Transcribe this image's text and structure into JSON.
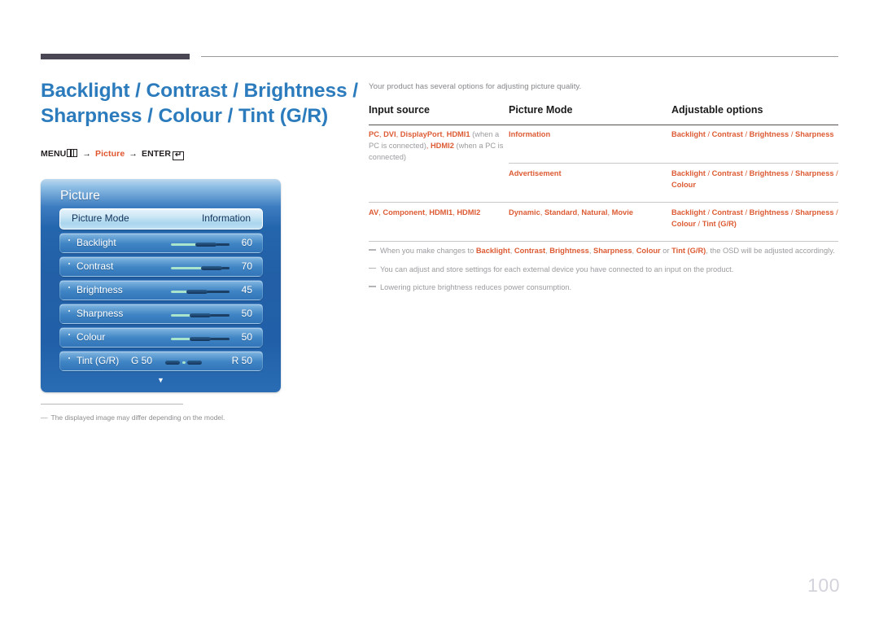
{
  "page_title": "Backlight / Contrast / Brightness / Sharpness / Colour / Tint (G/R)",
  "page_number": "100",
  "breadcrumb": {
    "menu_label": "MENU",
    "menu_icon": "menu-bars-icon",
    "arrow1": "→",
    "picture_label": "Picture",
    "arrow2": "→",
    "enter_label": "ENTER",
    "enter_icon": "↵"
  },
  "osd": {
    "title": "Picture",
    "scroll_arrow": "▼",
    "rows": [
      {
        "label": "Picture Mode",
        "value": "Information",
        "selected": true,
        "type": "option"
      },
      {
        "label": "Backlight",
        "value": "60",
        "selected": false,
        "type": "slider",
        "percent": 60
      },
      {
        "label": "Contrast",
        "value": "70",
        "selected": false,
        "type": "slider",
        "percent": 70
      },
      {
        "label": "Brightness",
        "value": "45",
        "selected": false,
        "type": "slider",
        "percent": 45
      },
      {
        "label": "Sharpness",
        "value": "50",
        "selected": false,
        "type": "slider",
        "percent": 50
      },
      {
        "label": "Colour",
        "value": "50",
        "selected": false,
        "type": "slider",
        "percent": 50
      },
      {
        "label": "Tint (G/R)",
        "value": "R 50",
        "left_value": "G 50",
        "selected": false,
        "type": "tint"
      }
    ],
    "footnote": "The displayed image may differ depending on the model."
  },
  "intro_text": "Your product has several options for adjusting picture quality.",
  "table": {
    "headers": [
      "Input source",
      "Picture Mode",
      "Adjustable options"
    ],
    "rows": [
      {
        "input_source_html": "<b>PC</b>, <b>DVI</b>, <b>DisplayPort</b>, <b>HDMI1</b> <span class=\"muted\">(when a PC is connected)</span>, <b>HDMI2</b> <span class=\"muted\">(when a PC is connected)</span>",
        "picture_mode_html": "<b>Information</b>",
        "options_html": "<b>Backlight</b> <span class=\"sep\">/</span> <b>Contrast</b> <span class=\"sep\">/</span> <b>Brightness</b> <span class=\"sep\">/</span> <b>Sharpness</b>"
      },
      {
        "input_source_html": "",
        "picture_mode_html": "<b>Advertisement</b>",
        "options_html": "<b>Backlight</b> <span class=\"sep\">/</span> <b>Contrast</b> <span class=\"sep\">/</span> <b>Brightness</b> <span class=\"sep\">/</span> <b>Sharpness</b> <span class=\"sep\">/</span> <b>Colour</b>"
      },
      {
        "input_source_html": "<b>AV</b>, <b>Component</b>, <b>HDMI1</b>, <b>HDMI2</b>",
        "picture_mode_html": "<b>Dynamic</b>, <b>Standard</b>, <b>Natural</b>, <b>Movie</b>",
        "options_html": "<b>Backlight</b> <span class=\"sep\">/</span> <b>Contrast</b> <span class=\"sep\">/</span> <b>Brightness</b> <span class=\"sep\">/</span> <b>Sharpness</b> <span class=\"sep\">/</span> <b>Colour</b> <span class=\"sep\">/</span> <b>Tint (G/R)</b>"
      }
    ]
  },
  "notes": [
    "When you make changes to <b>Backlight</b>, <b>Contrast</b>, <b>Brightness</b>, <b>Sharpness</b>, <b>Colour</b> or <b>Tint (G/R)</b>, the OSD will be adjusted accordingly.",
    "You can adjust and store settings for each external device you have connected to an input on the product.",
    "Lowering picture brightness reduces power consumption."
  ],
  "colors": {
    "title_blue": "#2b7bbd",
    "accent_orange": "#dd5b34",
    "muted_gray": "#9b9ba0",
    "rule_dark": "#4a4653",
    "osd_blue": "#2160a8"
  }
}
